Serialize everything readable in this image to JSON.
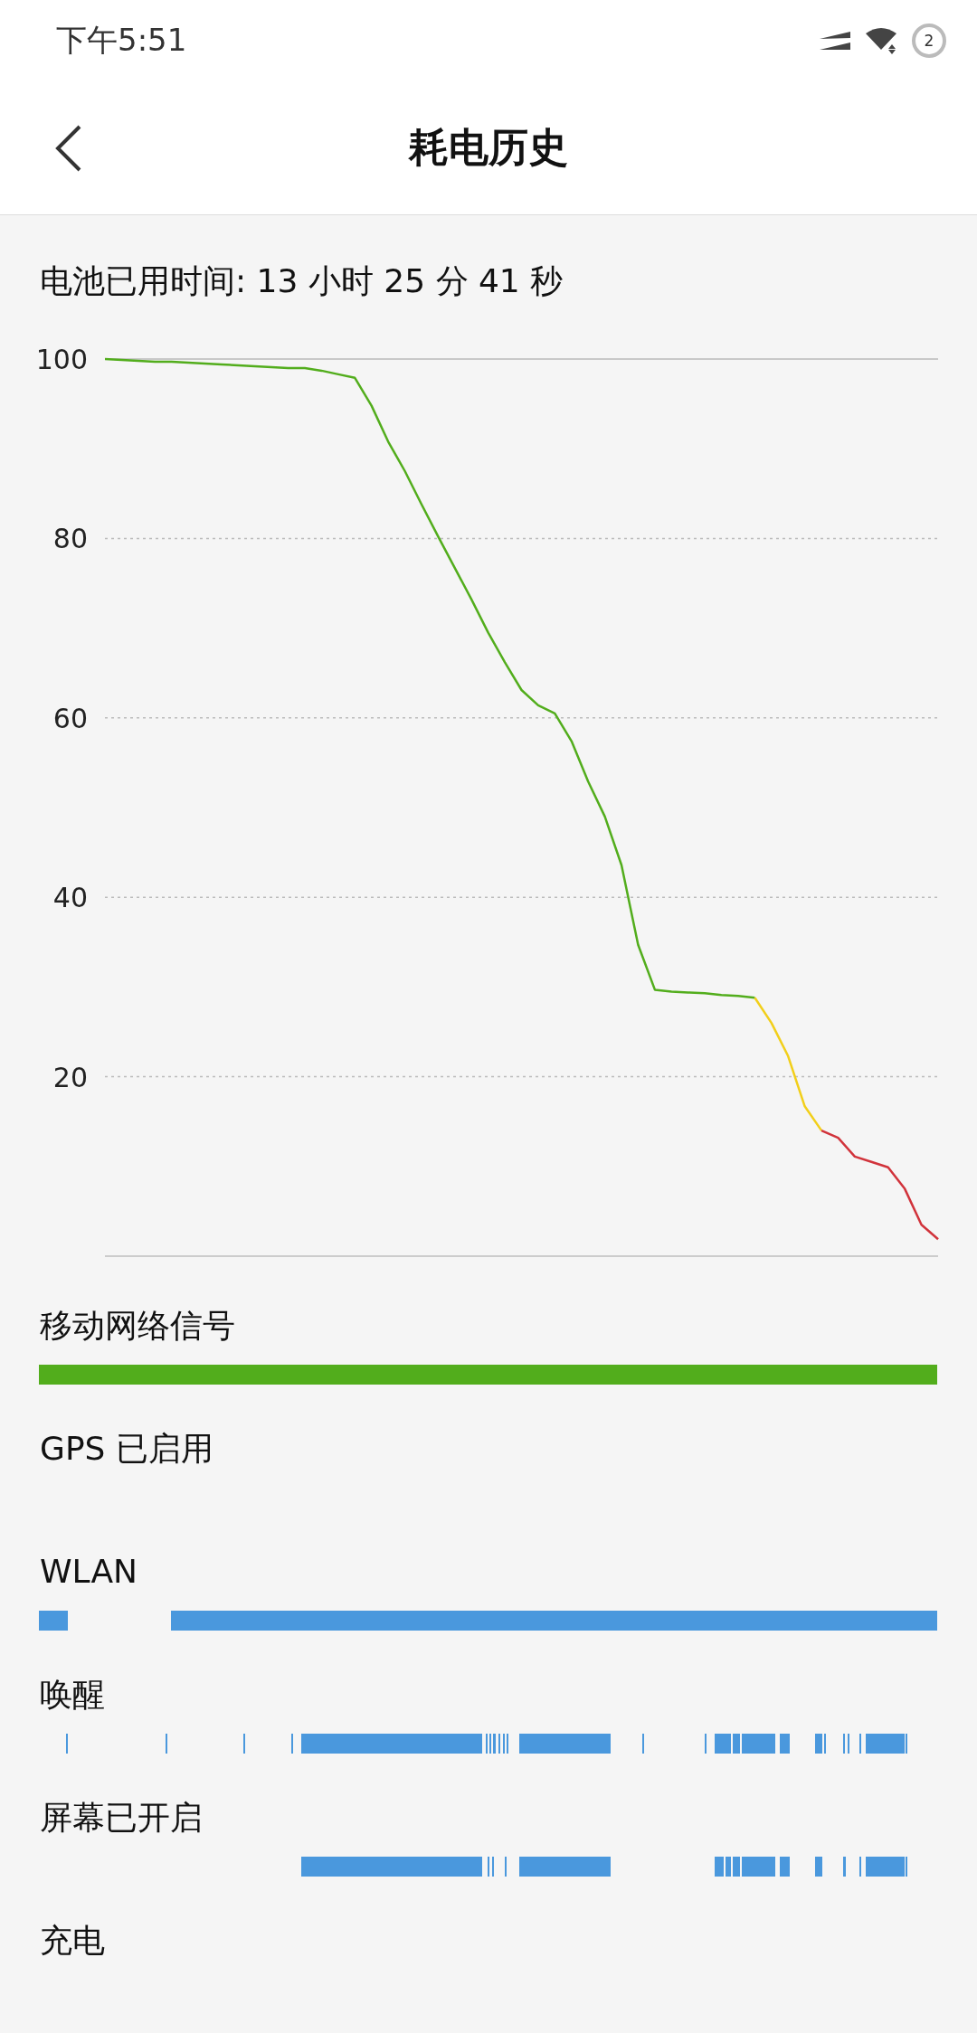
{
  "status_bar": {
    "time": "下午5:51",
    "notification_count": "2"
  },
  "header": {
    "title": "耗电历史"
  },
  "summary": "电池已用时间: 13 小时 25 分 41 秒",
  "battery_chart": {
    "chart_data": {
      "type": "line",
      "categories": [
        null,
        null,
        null,
        null,
        null,
        null,
        null,
        null,
        null,
        null,
        null,
        null,
        null,
        null,
        null,
        null,
        null,
        null,
        null,
        null,
        null,
        null,
        null,
        null,
        null,
        null,
        null,
        null,
        null,
        null,
        null,
        null,
        null,
        null,
        null,
        null,
        null,
        null,
        null,
        null,
        null,
        null,
        null,
        null,
        null,
        null,
        null,
        null,
        null,
        null,
        null
      ],
      "ylim": [
        0,
        100
      ],
      "yticks": [
        20,
        40,
        60,
        80,
        100
      ],
      "grid": true,
      "series": [
        {
          "color": "#52ad1c",
          "values": [
            100,
            99.9,
            99.8,
            99.7,
            99.7,
            99.6,
            99.5,
            99.4,
            99.3,
            99.2,
            99.1,
            99.0,
            99.0,
            98.7,
            98.3,
            97.9,
            94.8,
            90.8,
            87.5,
            83.8,
            80.2,
            76.7,
            73.2,
            69.5,
            66.2,
            63.1,
            61.4,
            60.5,
            57.4,
            52.9,
            49.0,
            43.6,
            34.7,
            29.7,
            29.5,
            29.4,
            29.3,
            29.1,
            29.0,
            28.8,
            null,
            null,
            null,
            null,
            null,
            null,
            null,
            null,
            null,
            null,
            null
          ]
        },
        {
          "color": "#f2cf1a",
          "values": [
            null,
            null,
            null,
            null,
            null,
            null,
            null,
            null,
            null,
            null,
            null,
            null,
            null,
            null,
            null,
            null,
            null,
            null,
            null,
            null,
            null,
            null,
            null,
            null,
            null,
            null,
            null,
            null,
            null,
            null,
            null,
            null,
            null,
            null,
            null,
            null,
            null,
            null,
            null,
            28.8,
            26.0,
            22.3,
            16.7,
            14.0,
            null,
            null,
            null,
            null,
            null,
            null,
            null
          ]
        },
        {
          "color": "#d1333b",
          "values": [
            null,
            null,
            null,
            null,
            null,
            null,
            null,
            null,
            null,
            null,
            null,
            null,
            null,
            null,
            null,
            null,
            null,
            null,
            null,
            null,
            null,
            null,
            null,
            null,
            null,
            null,
            null,
            null,
            null,
            null,
            null,
            null,
            null,
            null,
            null,
            null,
            null,
            null,
            null,
            null,
            null,
            null,
            null,
            14.0,
            13.2,
            11.1,
            10.5,
            9.9,
            7.5,
            3.5,
            1.9
          ]
        }
      ]
    }
  },
  "tracks": [
    {
      "label": "移动网络信号",
      "color": "#52ad1c"
    },
    {
      "label": "GPS 已启用"
    },
    {
      "label": "WLAN",
      "color": "#4a98dd"
    },
    {
      "label": "唤醒",
      "color": "#4a98dd"
    },
    {
      "label": "屏幕已开启",
      "color": "#4a98dd"
    },
    {
      "label": "充电"
    }
  ]
}
